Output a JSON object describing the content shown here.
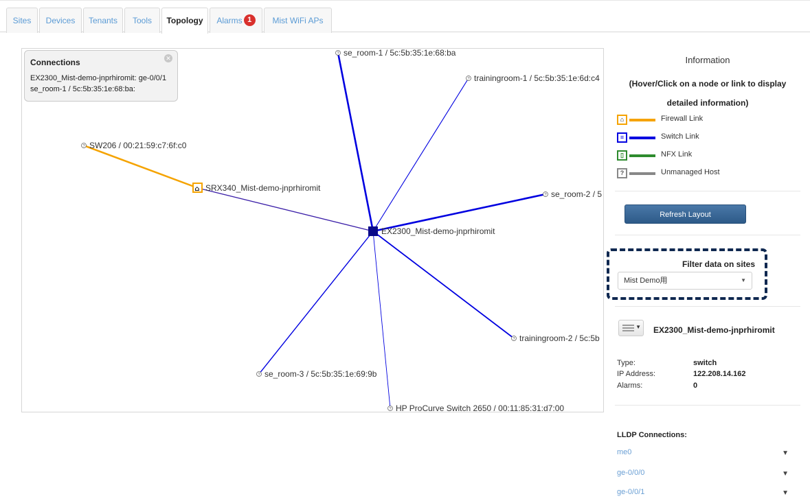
{
  "tabs": [
    {
      "label": "Sites"
    },
    {
      "label": "Devices"
    },
    {
      "label": "Tenants"
    },
    {
      "label": "Tools"
    },
    {
      "label": "Topology"
    },
    {
      "label": "Alarms",
      "badge": "1"
    },
    {
      "label": "Mist WiFi APs"
    }
  ],
  "colors": {
    "firewall_link": "#f5a300",
    "switch_link": "#0000e0",
    "nfx_link": "#2e8b2e",
    "unmanaged_link": "#888888",
    "tab_link": "#5b9bd5"
  },
  "connections_popup": {
    "title": "Connections",
    "line1": "EX2300_Mist-demo-jnprhiromit: ge-0/0/1",
    "line2": "se_room-1 / 5c:5b:35:1e:68:ba:"
  },
  "topology": {
    "nodes": [
      {
        "id": "ex2300",
        "label": "EX2300_Mist-demo-jnprhiromit",
        "kind": "switch"
      },
      {
        "id": "srx340",
        "label": "SRX340_Mist-demo-jnprhiromit",
        "kind": "firewall"
      },
      {
        "id": "sw206",
        "label": "SW206 / 00:21:59:c7:6f:c0",
        "kind": "unmanaged"
      },
      {
        "id": "se_room1",
        "label": "se_room-1 / 5c:5b:35:1e:68:ba",
        "kind": "unmanaged"
      },
      {
        "id": "trainingroom1",
        "label": "trainingroom-1 / 5c:5b:35:1e:6d:c4",
        "kind": "unmanaged"
      },
      {
        "id": "se_room2",
        "label": "se_room-2 / 5",
        "kind": "unmanaged"
      },
      {
        "id": "trainingroom2",
        "label": "trainingroom-2 / 5c:5b",
        "kind": "unmanaged"
      },
      {
        "id": "se_room3",
        "label": "se_room-3 / 5c:5b:35:1e:69:9b",
        "kind": "unmanaged"
      },
      {
        "id": "hp",
        "label": "HP ProCurve Switch 2650 / 00:11:85:31:d7:00",
        "kind": "unmanaged"
      }
    ],
    "links": [
      {
        "from": "sw206",
        "to": "srx340",
        "type": "firewall"
      },
      {
        "from": "srx340",
        "to": "ex2300",
        "type": "switch"
      },
      {
        "from": "ex2300",
        "to": "se_room1",
        "type": "switch"
      },
      {
        "from": "ex2300",
        "to": "trainingroom1",
        "type": "switch"
      },
      {
        "from": "ex2300",
        "to": "se_room2",
        "type": "switch"
      },
      {
        "from": "ex2300",
        "to": "trainingroom2",
        "type": "switch"
      },
      {
        "from": "ex2300",
        "to": "se_room3",
        "type": "switch"
      },
      {
        "from": "ex2300",
        "to": "hp",
        "type": "switch"
      }
    ]
  },
  "info": {
    "title": "Information",
    "subtitle_line1": "(Hover/Click on a node or link to display",
    "subtitle_line2": "detailed information)",
    "legend": [
      {
        "label": "Firewall Link",
        "icon": "firewall-icon"
      },
      {
        "label": "Switch Link",
        "icon": "switch-icon"
      },
      {
        "label": "NFX Link",
        "icon": "nfx-icon"
      },
      {
        "label": "Unmanaged Host",
        "icon": "unmanaged-host-icon"
      }
    ],
    "refresh_label": "Refresh Layout",
    "filter_label": "Filter data on sites",
    "filter_value": "Mist Demo用"
  },
  "device": {
    "name": "EX2300_Mist-demo-jnprhiromit",
    "type_label": "Type:",
    "type_value": "switch",
    "ip_label": "IP Address:",
    "ip_value": "122.208.14.162",
    "alarms_label": "Alarms:",
    "alarms_value": "0"
  },
  "lldp": {
    "title": "LLDP Connections:",
    "items": [
      "me0",
      "ge-0/0/0",
      "ge-0/0/1"
    ]
  }
}
